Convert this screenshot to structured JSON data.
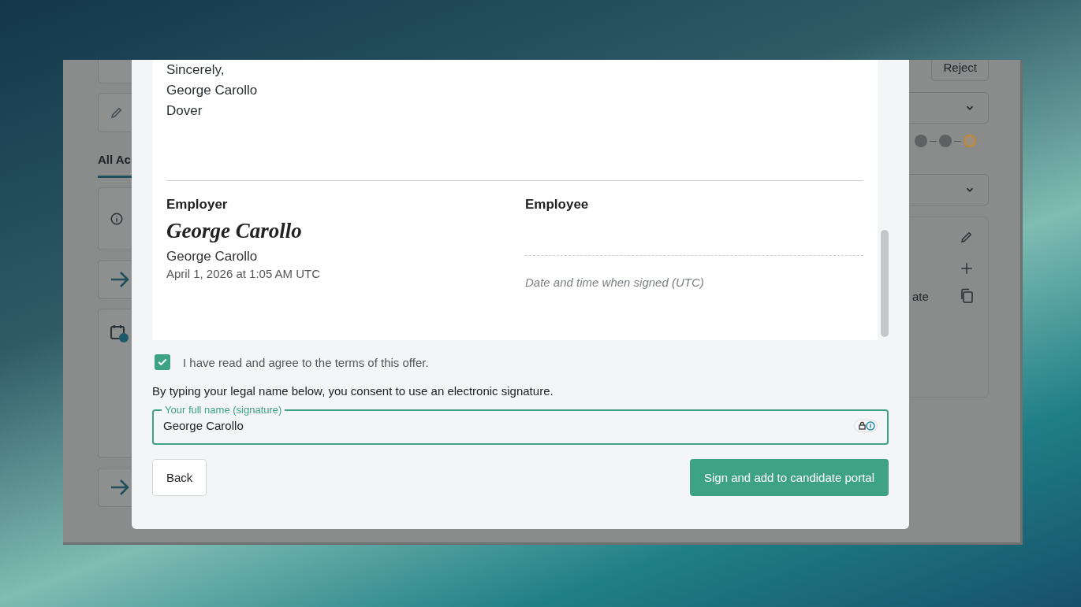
{
  "background_app": {
    "tab": "All Ac",
    "reject_button": "Reject",
    "stepper": [
      {
        "current": false
      },
      {
        "current": false
      },
      {
        "current": true
      }
    ],
    "cut_text": "ate"
  },
  "letter": {
    "closing_lines": [
      "Sincerely,",
      "George Carollo",
      "Dover"
    ],
    "signatures": [
      {
        "role": "Employer",
        "signed": true,
        "signature": "George Carollo",
        "name": "George Carollo",
        "date": "April 1, 2026 at 1:05 AM UTC"
      },
      {
        "role": "Employee",
        "signed": false,
        "date_placeholder": "Date and time when signed (UTC)"
      }
    ]
  },
  "agree": {
    "label": "I have read and agree to the terms of this offer.",
    "checked": true
  },
  "consent_text": "By typing your legal name below, you consent to use an electronic signature.",
  "signature_field": {
    "label": "Your full name (signature)",
    "value": "George Carollo"
  },
  "buttons": {
    "back": "Back",
    "submit": "Sign and add to candidate portal"
  }
}
